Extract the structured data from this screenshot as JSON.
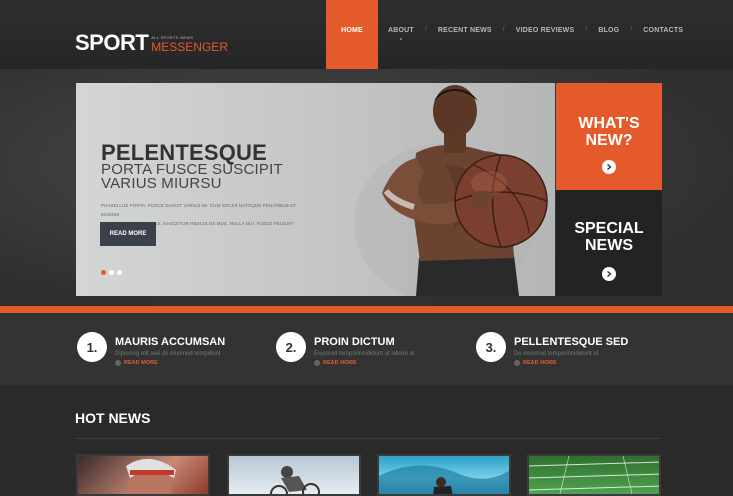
{
  "header": {
    "logo_main": "SPORT",
    "logo_tagline": "ALL SPORTS NEWS",
    "logo_sub": "MESSENGER",
    "nav": [
      {
        "label": "HOME",
        "active": true
      },
      {
        "label": "ABOUT"
      },
      {
        "label": "RECENT NEWS"
      },
      {
        "label": "VIDEO REVIEWS"
      },
      {
        "label": "BLOG"
      },
      {
        "label": "CONTACTS"
      }
    ]
  },
  "slider": {
    "title": "PELENTESQUE",
    "subtitle_line1": "PORTA FUSCE SUSCIPIT",
    "subtitle_line2": "VARIUS MIURSU",
    "text_line1": "PHASELLUS PORTA. FUSCE SUSCIT VARIUS MI. CUM SOCIIS NATOQUE PENATIBUS ET MAGNIS",
    "text_line2": "DIS PARTURIENT MONTES, NASCETUR RIDICULUS MUS. NULLA DUI. FUSCE FEUGIAT",
    "button": "READ MORE",
    "dots": 3,
    "active_dot": 0
  },
  "promo": {
    "whats_new": "WHAT'S NEW?",
    "special_news": "SPECIAL NEWS"
  },
  "features": [
    {
      "num": "1.",
      "title": "MAURIS ACCUMSAN",
      "desc": "Dipiscing elit sed do eiusmod tempidunt",
      "more": "READ MORE"
    },
    {
      "num": "2.",
      "title": "PROIN DICTUM",
      "desc": "Eiusmod temporincididunt ut labore et",
      "more": "READ MORE"
    },
    {
      "num": "3.",
      "title": "PELLENTESQUE SED",
      "desc": "Do eiusmod temporincididunt ut",
      "more": "READ MORE"
    }
  ],
  "hot_news": {
    "title": "HOT NEWS",
    "thumbs": [
      "volleyball-player-photo",
      "bmx-rider-photo",
      "surfer-photo",
      "football-field-photo"
    ]
  },
  "colors": {
    "accent": "#e55a2b",
    "dark": "#2b2b2b",
    "button": "#3a4148"
  }
}
